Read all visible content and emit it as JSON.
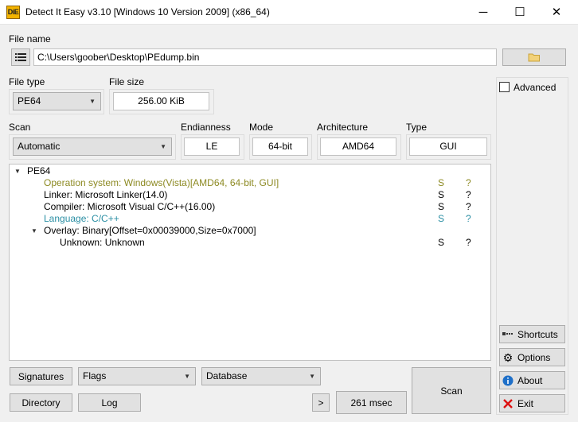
{
  "window": {
    "title": "Detect It Easy v3.10 [Windows 10 Version 2009] (x86_64)",
    "app_icon_text": "DiE",
    "controls": {
      "minimize": "─",
      "maximize": "☐",
      "close": "✕"
    }
  },
  "file": {
    "label": "File name",
    "path": "C:\\Users\\goober\\Desktop\\PEdump.bin"
  },
  "file_type": {
    "label": "File type",
    "value": "PE64"
  },
  "file_size": {
    "label": "File size",
    "value": "256.00 KiB"
  },
  "scan": {
    "label": "Scan",
    "value": "Automatic"
  },
  "endianness": {
    "label": "Endianness",
    "value": "LE"
  },
  "mode": {
    "label": "Mode",
    "value": "64-bit"
  },
  "architecture": {
    "label": "Architecture",
    "value": "AMD64"
  },
  "type": {
    "label": "Type",
    "value": "GUI"
  },
  "results": {
    "root": "PE64",
    "items": [
      {
        "text": "Operation system: Windows(Vista)[AMD64, 64-bit, GUI]",
        "s": "S",
        "q": "?",
        "color": "#8d8a23"
      },
      {
        "text": "Linker: Microsoft Linker(14.0)",
        "s": "S",
        "q": "?",
        "color": "#000000"
      },
      {
        "text": "Compiler: Microsoft Visual C/C++(16.00)",
        "s": "S",
        "q": "?",
        "color": "#000000"
      },
      {
        "text": "Language: C/C++",
        "s": "S",
        "q": "?",
        "color": "#2b8fa4"
      }
    ],
    "overlay": {
      "text": "Overlay: Binary[Offset=0x00039000,Size=0x7000]",
      "child": {
        "text": "Unknown: Unknown",
        "s": "S",
        "q": "?"
      }
    }
  },
  "advanced": {
    "label": "Advanced",
    "checked": false
  },
  "side_buttons": {
    "shortcuts": "Shortcuts",
    "options": "Options",
    "about": "About",
    "exit": "Exit"
  },
  "bottom": {
    "signatures": "Signatures",
    "flags": "Flags",
    "database": "Database",
    "directory": "Directory",
    "log": "Log",
    "more": ">",
    "elapsed": "261 msec",
    "scan": "Scan"
  }
}
